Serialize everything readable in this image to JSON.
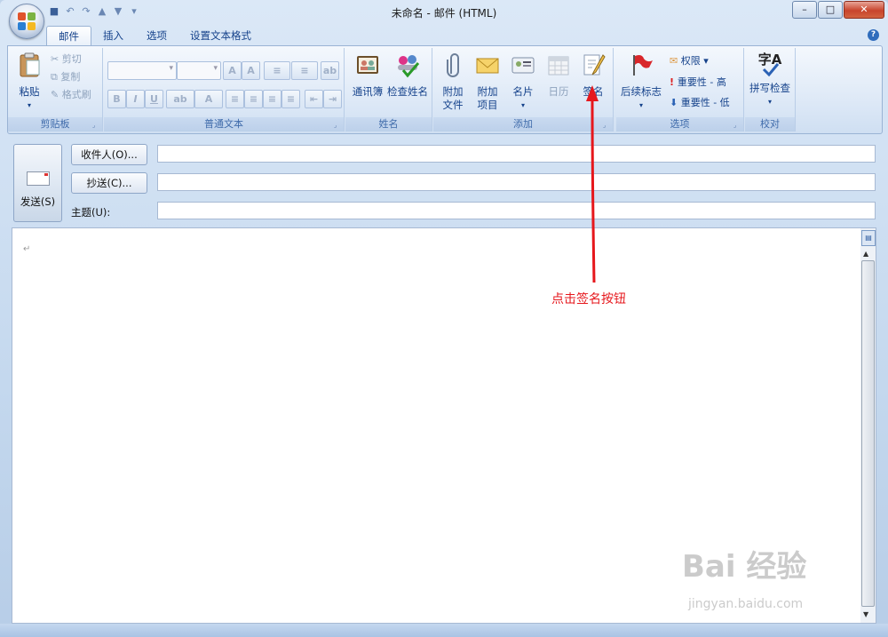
{
  "window": {
    "title": "未命名 - 邮件 (HTML)",
    "help": "?"
  },
  "tabs": [
    "邮件",
    "插入",
    "选项",
    "设置文本格式"
  ],
  "ribbon": {
    "clipboard": {
      "label": "剪贴板",
      "paste": "粘贴",
      "cut": "剪切",
      "copy": "复制",
      "format_painter": "格式刷"
    },
    "basic_text": {
      "label": "普通文本",
      "bold": "B",
      "italic": "I",
      "underline": "U"
    },
    "names": {
      "label": "姓名",
      "address_book": "通讯簿",
      "check_names": "检查姓名"
    },
    "include": {
      "label": "添加",
      "attach_file_1": "附加",
      "attach_file_2": "文件",
      "attach_item_1": "附加",
      "attach_item_2": "项目",
      "business_card": "名片",
      "calendar": "日历",
      "signature": "签名"
    },
    "options": {
      "label": "选项",
      "follow_up": "后续标志",
      "permission": "权限",
      "high_importance": "重要性 - 高",
      "low_importance": "重要性 - 低"
    },
    "proofing": {
      "label": "校对",
      "spelling": "拼写检查",
      "spell_icon_text": "字A"
    }
  },
  "form": {
    "send": "发送(S)",
    "to": "收件人(O)...",
    "cc": "抄送(C)...",
    "subject_label": "主题(U):",
    "to_value": "",
    "cc_value": "",
    "subject_value": ""
  },
  "body": {
    "paragraph_mark": "↵"
  },
  "annotation": {
    "text": "点击签名按钮",
    "color": "#e6171c"
  },
  "watermark": {
    "brand": "Bai 经验",
    "url": "jingyan.baidu.com"
  }
}
